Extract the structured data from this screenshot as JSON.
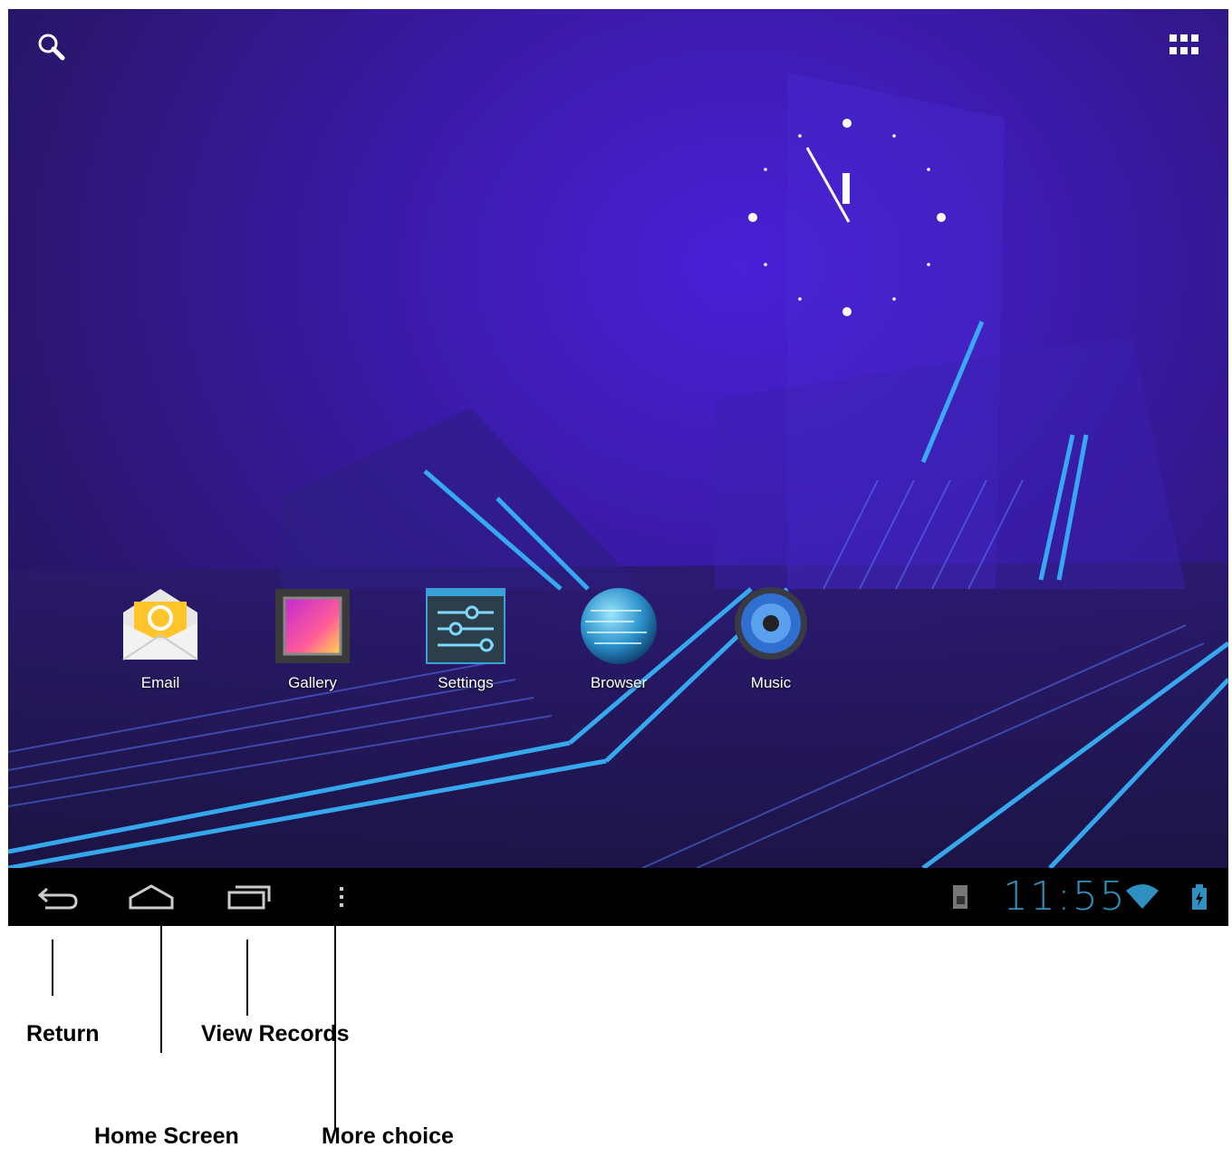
{
  "home": {
    "apps": [
      {
        "label": "Email",
        "icon": "email-icon"
      },
      {
        "label": "Gallery",
        "icon": "gallery-icon"
      },
      {
        "label": "Settings",
        "icon": "settings-icon"
      },
      {
        "label": "Browser",
        "icon": "browser-icon"
      },
      {
        "label": "Music",
        "icon": "music-icon"
      }
    ],
    "top_left_icon": "search-icon",
    "top_right_icon": "apps-grid-icon",
    "clock_widget": "analog-clock"
  },
  "navbar": {
    "buttons": [
      "back-icon",
      "home-icon",
      "recent-apps-icon",
      "menu-dots-icon"
    ],
    "status": {
      "time": "11:55",
      "icons": [
        "sd-card-icon",
        "wifi-icon",
        "battery-charging-icon"
      ],
      "time_color": "#2e8fc0"
    }
  },
  "callouts": {
    "return": "Return",
    "home_screen": "Home Screen",
    "view_records": "View Records",
    "more_choice": "More choice"
  }
}
